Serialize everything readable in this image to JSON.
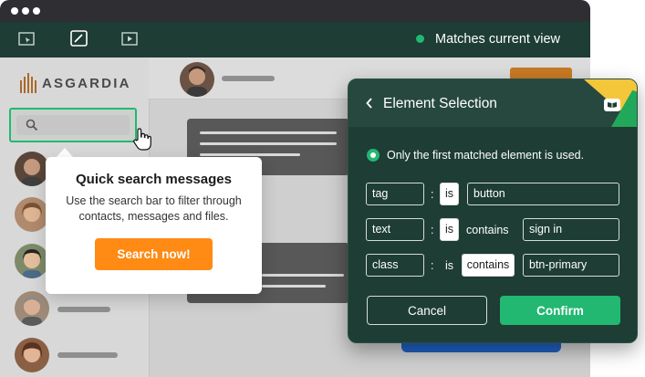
{
  "toolbar": {
    "status_text": "Matches current view",
    "status_color": "#22b872",
    "icons": [
      "select-area-icon",
      "edit-icon",
      "play-icon"
    ]
  },
  "sidebar": {
    "brand": "ASGARDIA",
    "search_placeholder": ""
  },
  "tooltip": {
    "title": "Quick search messages",
    "body": "Use the search bar to filter through contacts, messages and files.",
    "button_label": "Search now!",
    "button_color": "#ff8a14"
  },
  "panel": {
    "title": "Element Selection",
    "note": "Only the first matched element is used.",
    "rules": [
      {
        "attribute": "tag",
        "separator": ":",
        "operator": "is",
        "operator_extra": "",
        "value": "button"
      },
      {
        "attribute": "text",
        "separator": ":",
        "operator": "is",
        "operator_extra": "contains",
        "value": "sign in"
      },
      {
        "attribute": "class",
        "separator": ":",
        "operator": "is",
        "operator_extra": "contains",
        "value": "btn-primary"
      }
    ],
    "cancel_label": "Cancel",
    "confirm_label": "Confirm",
    "accent_color": "#22b872"
  }
}
